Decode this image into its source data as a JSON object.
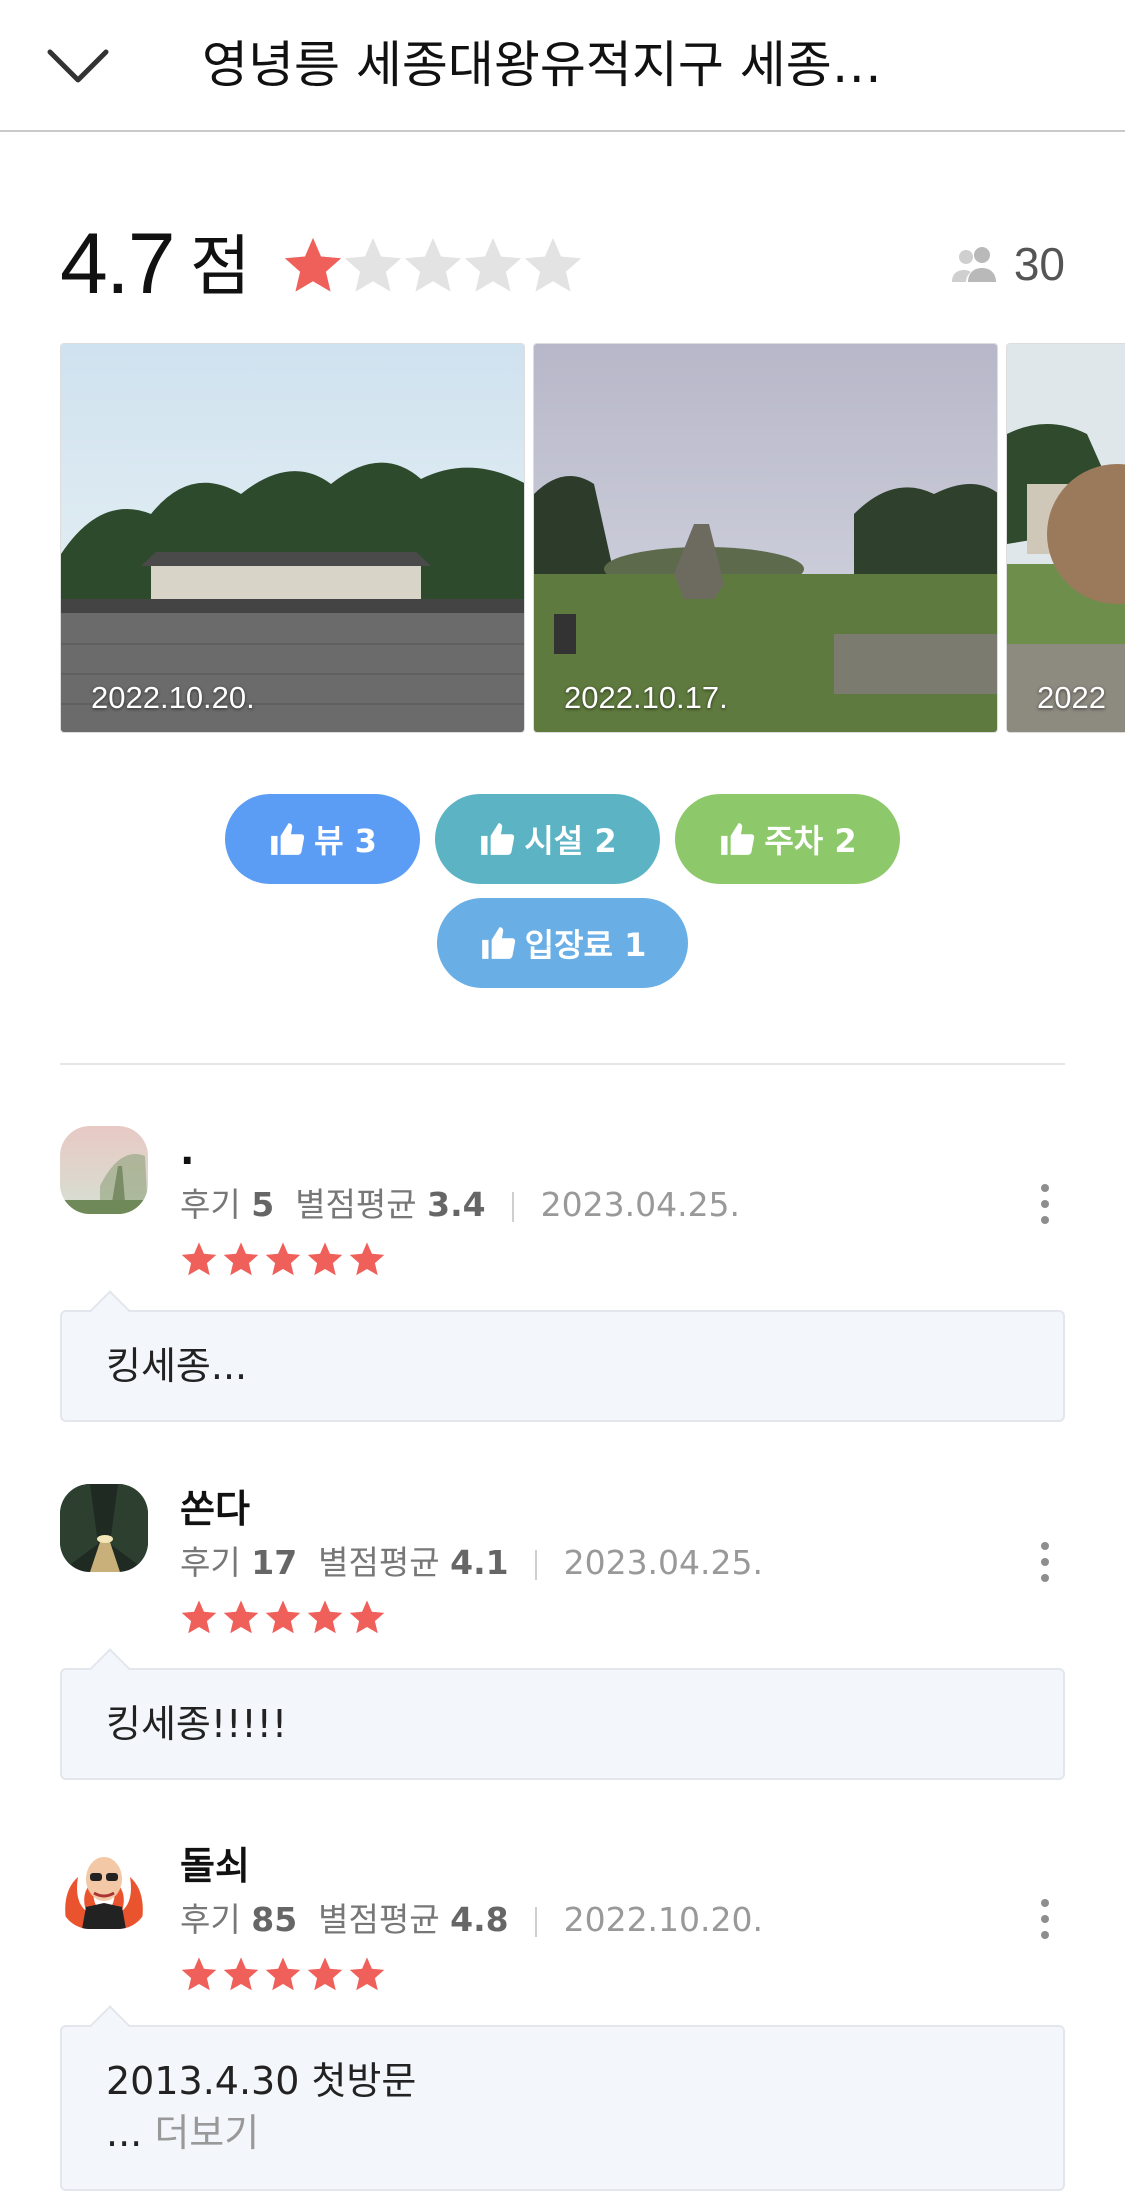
{
  "header": {
    "title": "영녕릉 세종대왕유적지구 세종…"
  },
  "summary": {
    "score": "4.7",
    "score_unit": "점",
    "rating": 4.7,
    "max_rating": 5,
    "reviewer_count": "30",
    "star_color": "#f0605b"
  },
  "photos": [
    {
      "date": "2022.10.20."
    },
    {
      "date": "2022.10.17."
    },
    {
      "date": "2022"
    }
  ],
  "tags": [
    {
      "label": "뷰 3",
      "color": "#5b9cf4"
    },
    {
      "label": "시설 2",
      "color": "#5bb3c4"
    },
    {
      "label": "주차 2",
      "color": "#8dc96a"
    },
    {
      "label": "입장료 1",
      "color": "#6aaee6"
    }
  ],
  "reviews": [
    {
      "name": ".",
      "review_label": "후기",
      "review_count": "5",
      "avg_label": "별점평균",
      "avg": "3.4",
      "date": "2023.04.25.",
      "stars": 5,
      "text": "킹세종..."
    },
    {
      "name": "쏜다",
      "review_label": "후기",
      "review_count": "17",
      "avg_label": "별점평균",
      "avg": "4.1",
      "date": "2023.04.25.",
      "stars": 5,
      "text": "킹세종!!!!!"
    },
    {
      "name": "돌쇠",
      "review_label": "후기",
      "review_count": "85",
      "avg_label": "별점평균",
      "avg": "4.8",
      "date": "2022.10.20.",
      "stars": 5,
      "text": "2013.4.30  첫방문",
      "ellipsis": "...",
      "more_label": "더보기"
    }
  ]
}
